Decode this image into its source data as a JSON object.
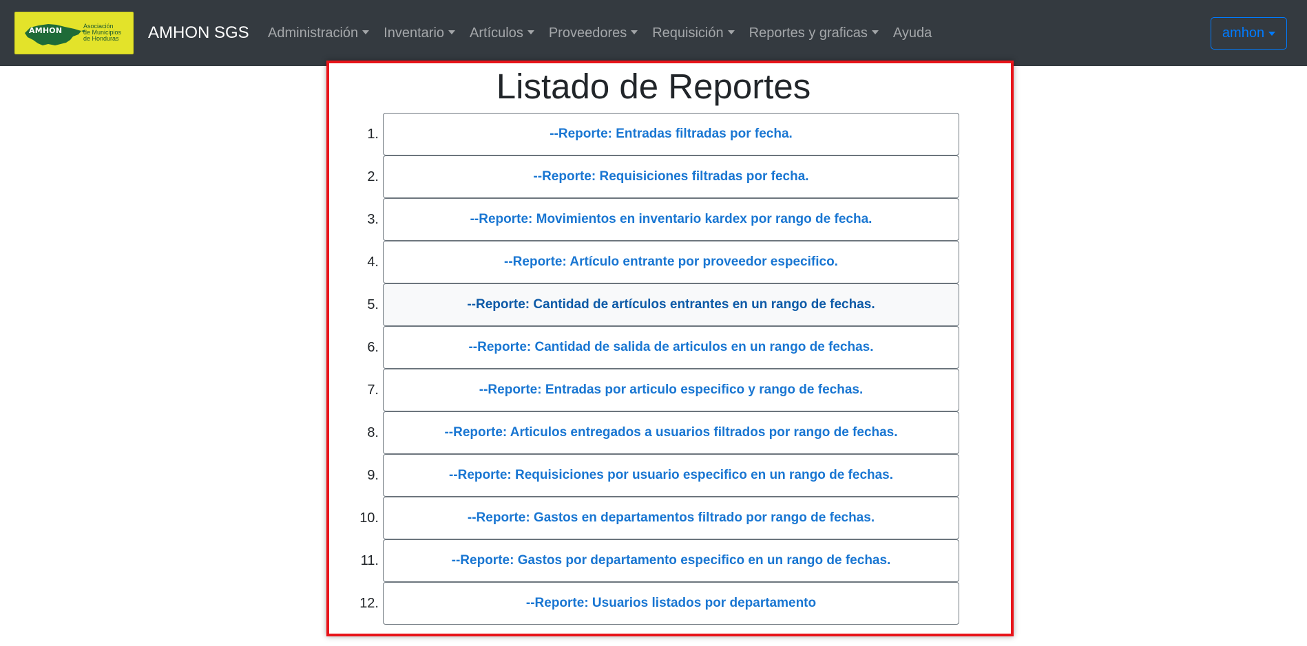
{
  "navbar": {
    "logo": {
      "abbr": "AMHON",
      "line1": "Asociación",
      "line2": "de Municipios",
      "line3": "de Honduras"
    },
    "brand": "AMHON SGS",
    "items": [
      {
        "label": "Administración",
        "dropdown": true
      },
      {
        "label": "Inventario",
        "dropdown": true
      },
      {
        "label": "Artículos",
        "dropdown": true
      },
      {
        "label": "Proveedores",
        "dropdown": true
      },
      {
        "label": "Requisición",
        "dropdown": true
      },
      {
        "label": "Reportes y graficas",
        "dropdown": true
      },
      {
        "label": "Ayuda",
        "dropdown": false
      }
    ],
    "user": "amhon"
  },
  "main": {
    "title": "Listado de Reportes",
    "reports": [
      {
        "num": "1.",
        "label": "--Reporte: Entradas filtradas por fecha."
      },
      {
        "num": "2.",
        "label": "--Reporte: Requisiciones filtradas por fecha."
      },
      {
        "num": "3.",
        "label": "--Reporte: Movimientos en inventario kardex por rango de fecha."
      },
      {
        "num": "4.",
        "label": "--Reporte: Artículo entrante por proveedor especifico."
      },
      {
        "num": "5.",
        "label": "--Reporte: Cantidad de artículos entrantes en un rango de fechas.",
        "hover": true
      },
      {
        "num": "6.",
        "label": "--Reporte: Cantidad de salida de articulos en un rango de fechas."
      },
      {
        "num": "7.",
        "label": "--Reporte: Entradas por articulo especifico y rango de fechas."
      },
      {
        "num": "8.",
        "label": "--Reporte: Articulos entregados a usuarios filtrados por rango de fechas."
      },
      {
        "num": "9.",
        "label": "--Reporte: Requisiciones por usuario especifico en un rango de fechas."
      },
      {
        "num": "10.",
        "label": "--Reporte: Gastos en departamentos filtrado por rango de fechas."
      },
      {
        "num": "11.",
        "label": "--Reporte: Gastos por departamento especifico en un rango de fechas."
      },
      {
        "num": "12.",
        "label": "--Reporte: Usuarios listados por departamento"
      }
    ]
  },
  "colors": {
    "navbar_bg": "#343a40",
    "logo_bg": "#e3e32a",
    "link_blue": "#1976d2",
    "user_outline": "#007bff",
    "highlight_red": "#e8141a"
  }
}
